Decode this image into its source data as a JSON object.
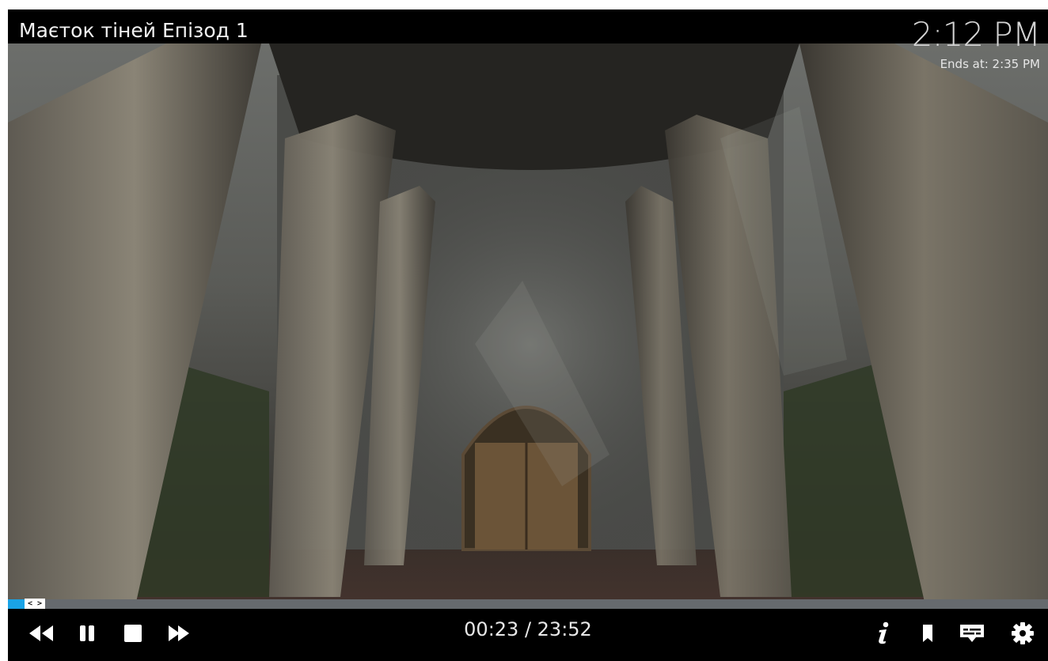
{
  "header": {
    "title": "Маєток тіней Епізод 1",
    "clock": "2:12 PM",
    "ends_at": "Ends at: 2:35 PM"
  },
  "seek": {
    "progress": 0.016,
    "thumb_label": "< >",
    "fill_color": "#1aa3e6"
  },
  "controls": {
    "time_display": "00:23 / 23:52",
    "left_buttons": [
      "rewind-icon",
      "pause-icon",
      "stop-icon",
      "fast-forward-icon"
    ],
    "right_buttons": [
      "info-icon",
      "bookmark-icon",
      "subtitles-icon",
      "settings-icon"
    ]
  }
}
